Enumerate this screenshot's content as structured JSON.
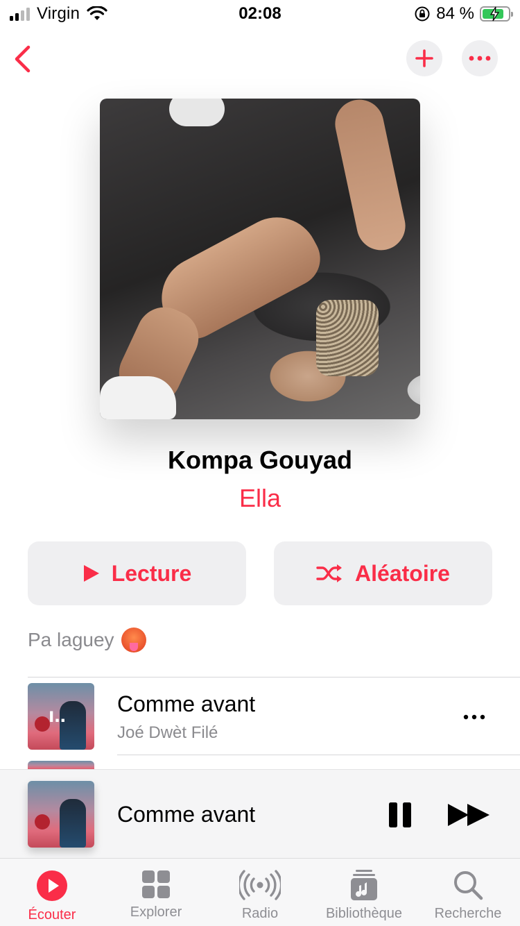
{
  "status_bar": {
    "carrier": "Virgin",
    "time": "02:08",
    "battery_text": "84 %",
    "battery_level": 0.84
  },
  "nav": {
    "back_icon": "chevron-left-icon",
    "add_icon": "plus-icon",
    "more_icon": "ellipsis-icon"
  },
  "album": {
    "title": "Kompa Gouyad",
    "artist": "Ella",
    "description": "Pa laguey"
  },
  "actions": {
    "play_label": "Lecture",
    "shuffle_label": "Aléatoire"
  },
  "tracks": [
    {
      "title": "Comme avant",
      "artist": "Joé Dwèt Filé"
    }
  ],
  "now_playing": {
    "title": "Comme avant"
  },
  "tabs": [
    {
      "label": "Écouter",
      "icon": "play-circle-icon",
      "active": true
    },
    {
      "label": "Explorer",
      "icon": "grid-icon",
      "active": false
    },
    {
      "label": "Radio",
      "icon": "radio-waves-icon",
      "active": false
    },
    {
      "label": "Bibliothèque",
      "icon": "library-icon",
      "active": false
    },
    {
      "label": "Recherche",
      "icon": "search-icon",
      "active": false
    }
  ],
  "colors": {
    "accent": "#fa2d48",
    "secondary_text": "#8a8a8e",
    "button_bg": "#efeff1"
  }
}
